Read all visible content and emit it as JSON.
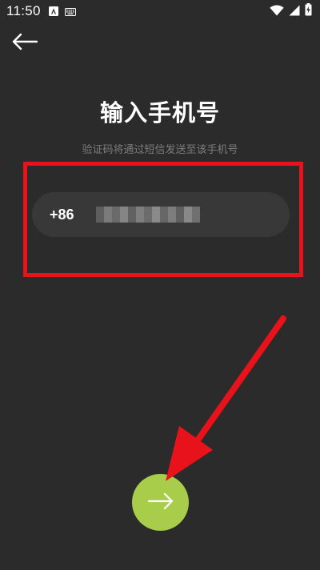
{
  "status_bar": {
    "time": "11:50"
  },
  "header": {
    "back_icon": "arrow-left-icon"
  },
  "main": {
    "title": "输入手机号",
    "subtitle": "验证码将通过短信发送至该手机号"
  },
  "phone_input": {
    "country_code": "+86",
    "value_obscured": true
  },
  "next_button": {
    "icon": "arrow-right-icon"
  },
  "colors": {
    "background": "#2b2b2b",
    "input_background": "#383838",
    "accent": "#a8cd4a",
    "annotation": "#e8121a",
    "subtitle": "#7c7c7c"
  }
}
